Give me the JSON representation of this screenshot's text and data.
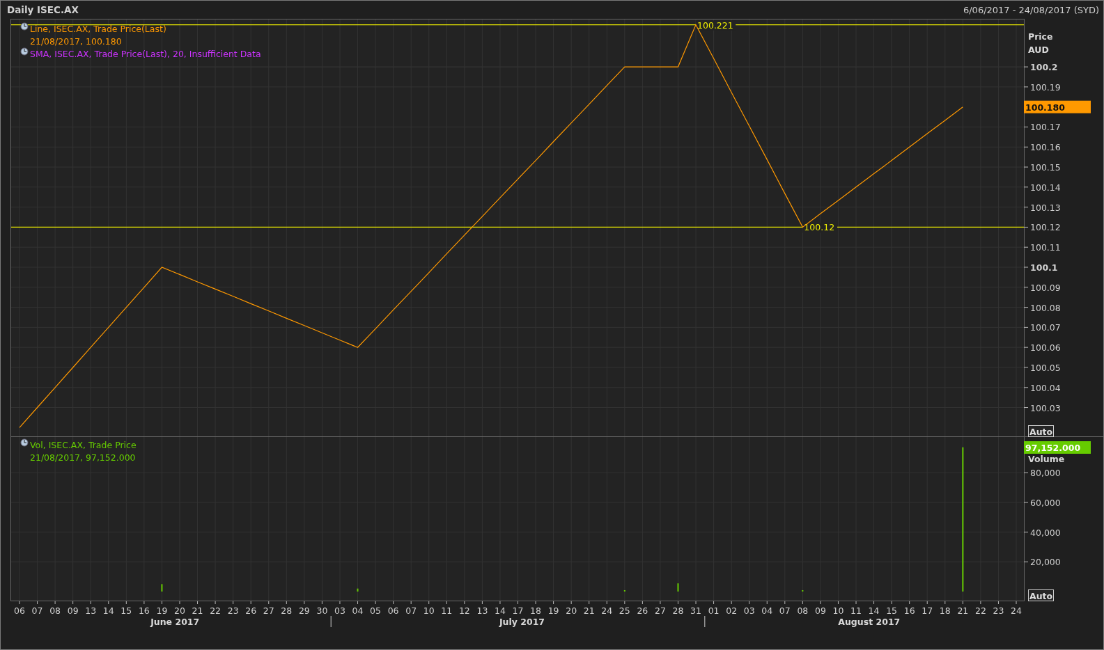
{
  "header": {
    "title": "Daily ISEC.AX",
    "range": "6/06/2017 - 24/08/2017 (SYD)"
  },
  "price_panel": {
    "legend_detail": "21/08/2017, 100.180",
    "indicator": {
      "text": "SMA, ISEC.AX, Trade Price(Last),  20, Insufficient Data",
      "color": "#cc33ff"
    },
    "axis_title": [
      "Price",
      "AUD"
    ],
    "last_value": "100.180",
    "scale_button": "Auto",
    "chart_data": {
      "type": "line",
      "categories": [
        null,
        null,
        null,
        null,
        null,
        null,
        null,
        null,
        null,
        null,
        null,
        null,
        null,
        null,
        null,
        null,
        null,
        null,
        null,
        null,
        null,
        null,
        null,
        null,
        null,
        null,
        null,
        null,
        null,
        null,
        null,
        null,
        null,
        null,
        null,
        null,
        null,
        null,
        null,
        null,
        null,
        null,
        null,
        null,
        null,
        null,
        null,
        null,
        null,
        null,
        null,
        null,
        null,
        null
      ],
      "series": [
        {
          "name": "Line, ISEC.AX, Trade Price(Last)",
          "color": "#ff9900",
          "values": [
            100.02,
            100.03,
            100.04,
            100.05,
            100.06,
            100.07,
            100.08,
            100.09,
            100.1,
            100.0964,
            100.0927,
            100.0891,
            100.0855,
            100.0818,
            100.0782,
            100.0745,
            100.0709,
            100.0673,
            100.0636,
            100.06,
            100.0693,
            100.0787,
            100.088,
            100.0973,
            100.1067,
            100.116,
            100.1253,
            100.1347,
            100.144,
            100.1533,
            100.1627,
            100.172,
            100.1813,
            100.1907,
            100.2,
            100.2,
            100.2,
            100.2,
            100.221,
            100.2042,
            100.1873,
            100.1705,
            100.1537,
            100.1368,
            100.12,
            100.1267,
            100.1333,
            100.14,
            100.1467,
            100.1533,
            100.16,
            100.1667,
            100.1733,
            100.18
          ]
        }
      ],
      "ylim": [
        100.0156,
        100.224
      ],
      "yticks": [
        100.03,
        100.04,
        100.05,
        100.06,
        100.07,
        100.08,
        100.09,
        100.1,
        100.11,
        100.12,
        100.13,
        100.14,
        100.15,
        100.16,
        100.17,
        100.19,
        100.2
      ],
      "ref_lines": [
        {
          "axis": "y",
          "value": 100.221,
          "label": "100.221"
        },
        {
          "axis": "y",
          "value": 100.12,
          "label": "100.12"
        }
      ]
    }
  },
  "volume_panel": {
    "legend_detail": "21/08/2017, 97,152.000",
    "axis_title": "Volume",
    "last_value": "97,152.000",
    "scale_button": "Auto",
    "chart_data": {
      "type": "bar",
      "categories": [
        "06",
        "07",
        "08",
        "09",
        "13",
        "14",
        "15",
        "16",
        "19",
        "20",
        "21",
        "22",
        "23",
        "26",
        "27",
        "28",
        "29",
        "30",
        "03",
        "04",
        "05",
        "06",
        "07",
        "10",
        "11",
        "12",
        "13",
        "14",
        "17",
        "18",
        "19",
        "20",
        "21",
        "24",
        "25",
        "26",
        "27",
        "28",
        "31",
        "01",
        "02",
        "03",
        "04",
        "07",
        "08",
        "09",
        "10",
        "11",
        "14",
        "15",
        "16",
        "17",
        "18",
        "21",
        "22",
        "23",
        "24"
      ],
      "series": [
        {
          "name": "Vol, ISEC.AX, Trade Price",
          "color": "#66cc00",
          "values": [
            0,
            0,
            0,
            0,
            0,
            0,
            0,
            0,
            5000,
            0,
            0,
            0,
            0,
            0,
            0,
            0,
            0,
            0,
            0,
            2000,
            0,
            0,
            0,
            0,
            0,
            0,
            0,
            0,
            0,
            0,
            0,
            0,
            0,
            0,
            500,
            0,
            0,
            5500,
            0,
            0,
            0,
            0,
            0,
            0,
            500,
            0,
            0,
            0,
            0,
            0,
            0,
            0,
            0,
            97152,
            0,
            0,
            0
          ]
        }
      ],
      "ylim": [
        -6100,
        104500
      ],
      "yticks": [
        {
          "value": 20000,
          "label": "20,000"
        },
        {
          "value": 40000,
          "label": "40,000"
        },
        {
          "value": 60000,
          "label": "60,000"
        },
        {
          "value": 80000,
          "label": "80,000"
        }
      ]
    }
  },
  "months": [
    {
      "label": "June 2017"
    },
    {
      "label": "July 2017"
    },
    {
      "label": "August 2017"
    }
  ]
}
